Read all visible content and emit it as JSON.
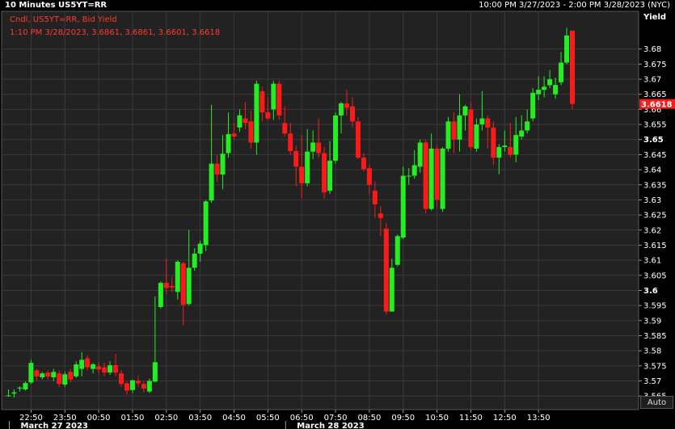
{
  "header": {
    "title": "10 Minutes US5YT=RR",
    "range": "10:00 PM 3/27/2023 - 2:00 PM 3/28/2023 (NYC)"
  },
  "legend": {
    "line1": "Cndl, US5YT=RR, Bid Yield",
    "line2": "1:10 PM 3/28/2023, 3.6861, 3.6861, 3.6601, 3.6618"
  },
  "axis": {
    "y_label": "Yield",
    "auto_label": "Auto",
    "last_price": "3.6618"
  },
  "colors": {
    "up": "#22ee22",
    "down": "#ff1a1a",
    "grid": "#3a3a3a",
    "plot_bg": "#222222",
    "price_tag": "#ff1a1a"
  },
  "chart_data": {
    "type": "candlestick",
    "ylabel": "Yield",
    "ylim": [
      3.5605,
      3.6925
    ],
    "y_ticks": [
      {
        "value": 3.68,
        "label": "3.68",
        "bold": false
      },
      {
        "value": 3.675,
        "label": "3.675",
        "bold": false
      },
      {
        "value": 3.67,
        "label": "3.67",
        "bold": false
      },
      {
        "value": 3.665,
        "label": "3.665",
        "bold": false
      },
      {
        "value": 3.66,
        "label": "3.66",
        "bold": false
      },
      {
        "value": 3.655,
        "label": "3.655",
        "bold": false
      },
      {
        "value": 3.65,
        "label": "3.65",
        "bold": true
      },
      {
        "value": 3.645,
        "label": "3.645",
        "bold": false
      },
      {
        "value": 3.64,
        "label": "3.64",
        "bold": false
      },
      {
        "value": 3.635,
        "label": "3.635",
        "bold": false
      },
      {
        "value": 3.63,
        "label": "3.63",
        "bold": false
      },
      {
        "value": 3.625,
        "label": "3.625",
        "bold": false
      },
      {
        "value": 3.62,
        "label": "3.62",
        "bold": false
      },
      {
        "value": 3.615,
        "label": "3.615",
        "bold": false
      },
      {
        "value": 3.61,
        "label": "3.61",
        "bold": false
      },
      {
        "value": 3.605,
        "label": "3.605",
        "bold": false
      },
      {
        "value": 3.6,
        "label": "3.6",
        "bold": true
      },
      {
        "value": 3.595,
        "label": "3.595",
        "bold": false
      },
      {
        "value": 3.59,
        "label": "3.59",
        "bold": false
      },
      {
        "value": 3.585,
        "label": "3.585",
        "bold": false
      },
      {
        "value": 3.58,
        "label": "3.58",
        "bold": false
      },
      {
        "value": 3.575,
        "label": "3.575",
        "bold": false
      },
      {
        "value": 3.57,
        "label": "3.57",
        "bold": false
      },
      {
        "value": 3.565,
        "label": "3.565",
        "bold": false
      }
    ],
    "x_ticks": [
      {
        "index": 4,
        "label": "22:50"
      },
      {
        "index": 10,
        "label": "23:50"
      },
      {
        "index": 16,
        "label": "00:50"
      },
      {
        "index": 22,
        "label": "01:50"
      },
      {
        "index": 28,
        "label": "02:50"
      },
      {
        "index": 34,
        "label": "03:50"
      },
      {
        "index": 40,
        "label": "04:50"
      },
      {
        "index": 46,
        "label": "05:50"
      },
      {
        "index": 52,
        "label": "06:50"
      },
      {
        "index": 58,
        "label": "07:50"
      },
      {
        "index": 64,
        "label": "08:50"
      },
      {
        "index": 70,
        "label": "09:50"
      },
      {
        "index": 76,
        "label": "10:50"
      },
      {
        "index": 82,
        "label": "11:50"
      },
      {
        "index": 88,
        "label": "12:50"
      },
      {
        "index": 94,
        "label": "13:50"
      }
    ],
    "date_labels": [
      {
        "index": 0,
        "label": "March 27 2023"
      },
      {
        "index": 49,
        "label": "March 28 2023"
      }
    ],
    "candles": [
      [
        3.5652,
        3.5652,
        3.5648,
        3.5672
      ],
      [
        3.5658,
        3.5662,
        3.5645,
        3.5672
      ],
      [
        3.5675,
        3.5678,
        3.5665,
        3.5682
      ],
      [
        3.5672,
        3.5693,
        3.5668,
        3.5698
      ],
      [
        3.5695,
        3.576,
        3.569,
        3.577
      ],
      [
        3.5735,
        3.5715,
        3.57,
        3.574
      ],
      [
        3.5712,
        3.5725,
        3.5705,
        3.573
      ],
      [
        3.5728,
        3.5715,
        3.5705,
        3.5735
      ],
      [
        3.5712,
        3.573,
        3.57,
        3.574
      ],
      [
        3.5725,
        3.569,
        3.568,
        3.5735
      ],
      [
        3.5688,
        3.5722,
        3.568,
        3.573
      ],
      [
        3.573,
        3.5705,
        3.5695,
        3.574
      ],
      [
        3.5715,
        3.5755,
        3.571,
        3.5765
      ],
      [
        3.574,
        3.577,
        3.5715,
        3.5795
      ],
      [
        3.5775,
        3.5745,
        3.5735,
        3.5785
      ],
      [
        3.574,
        3.5755,
        3.5725,
        3.576
      ],
      [
        3.5748,
        3.5738,
        3.5725,
        3.5765
      ],
      [
        3.5745,
        3.5728,
        3.5715,
        3.576
      ],
      [
        3.5728,
        3.5752,
        3.572,
        3.5765
      ],
      [
        3.5752,
        3.5728,
        3.5715,
        3.579
      ],
      [
        3.5725,
        3.569,
        3.568,
        3.5735
      ],
      [
        3.5692,
        3.5668,
        3.5655,
        3.5698
      ],
      [
        3.567,
        3.5702,
        3.566,
        3.5705
      ],
      [
        3.57,
        3.5692,
        3.568,
        3.5718
      ],
      [
        3.569,
        3.5675,
        3.5662,
        3.57
      ],
      [
        3.5665,
        3.57,
        3.566,
        3.5708
      ],
      [
        3.5698,
        3.5762,
        3.5695,
        3.598
      ],
      [
        3.5945,
        3.6025,
        3.594,
        3.603
      ],
      [
        3.6025,
        3.6008,
        3.599,
        3.6105
      ],
      [
        3.6015,
        3.601,
        3.5995,
        3.6045
      ],
      [
        3.5995,
        3.6095,
        3.597,
        3.61
      ],
      [
        3.609,
        3.5952,
        3.5885,
        3.6095
      ],
      [
        3.5955,
        3.6075,
        3.595,
        3.62
      ],
      [
        3.6075,
        3.6122,
        3.6065,
        3.614
      ],
      [
        3.6122,
        3.6155,
        3.6095,
        3.6165
      ],
      [
        3.615,
        3.6295,
        3.613,
        3.63
      ],
      [
        3.6298,
        3.642,
        3.629,
        3.6615
      ],
      [
        3.642,
        3.6384,
        3.636,
        3.645
      ],
      [
        3.6384,
        3.6453,
        3.6335,
        3.6515
      ],
      [
        3.6455,
        3.6518,
        3.644,
        3.659
      ],
      [
        3.652,
        3.651,
        3.65,
        3.6555
      ],
      [
        3.654,
        3.658,
        3.6525,
        3.66
      ],
      [
        3.657,
        3.6555,
        3.6535,
        3.6625
      ],
      [
        3.656,
        3.649,
        3.647,
        3.6595
      ],
      [
        3.649,
        3.6685,
        3.645,
        3.6695
      ],
      [
        3.666,
        3.659,
        3.656,
        3.6675
      ],
      [
        3.659,
        3.657,
        3.6565,
        3.664
      ],
      [
        3.66,
        3.6685,
        3.6565,
        3.6695
      ],
      [
        3.6685,
        3.658,
        3.6565,
        3.6695
      ],
      [
        3.6555,
        3.652,
        3.651,
        3.661
      ],
      [
        3.652,
        3.6462,
        3.645,
        3.6555
      ],
      [
        3.6462,
        3.641,
        3.6345,
        3.648
      ],
      [
        3.641,
        3.6355,
        3.6305,
        3.6515
      ],
      [
        3.6355,
        3.646,
        3.6345,
        3.6535
      ],
      [
        3.646,
        3.649,
        3.6435,
        3.653
      ],
      [
        3.649,
        3.6455,
        3.644,
        3.657
      ],
      [
        3.6455,
        3.6325,
        3.6305,
        3.6475
      ],
      [
        3.633,
        3.643,
        3.632,
        3.6495
      ],
      [
        3.643,
        3.658,
        3.642,
        3.659
      ],
      [
        3.658,
        3.662,
        3.652,
        3.6625
      ],
      [
        3.662,
        3.6605,
        3.658,
        3.6665
      ],
      [
        3.661,
        3.656,
        3.654,
        3.664
      ],
      [
        3.656,
        3.644,
        3.6435,
        3.6575
      ],
      [
        3.644,
        3.6402,
        3.6395,
        3.6455
      ],
      [
        3.6405,
        3.635,
        3.632,
        3.6415
      ],
      [
        3.633,
        3.6285,
        3.624,
        3.636
      ],
      [
        3.6255,
        3.624,
        3.618,
        3.628
      ],
      [
        3.6205,
        3.593,
        3.592,
        3.6225
      ],
      [
        3.593,
        3.6075,
        3.593,
        3.6105
      ],
      [
        3.6085,
        3.618,
        3.608,
        3.6185
      ],
      [
        3.6175,
        3.638,
        3.617,
        3.641
      ],
      [
        3.638,
        3.638,
        3.635,
        3.6405
      ],
      [
        3.638,
        3.6415,
        3.637,
        3.6465
      ],
      [
        3.641,
        3.649,
        3.639,
        3.65
      ],
      [
        3.649,
        3.627,
        3.6255,
        3.65
      ],
      [
        3.627,
        3.647,
        3.6265,
        3.652
      ],
      [
        3.647,
        3.63,
        3.6275,
        3.648
      ],
      [
        3.627,
        3.647,
        3.626,
        3.6475
      ],
      [
        3.647,
        3.656,
        3.646,
        3.6575
      ],
      [
        3.656,
        3.65,
        3.6455,
        3.659
      ],
      [
        3.65,
        3.658,
        3.646,
        3.665
      ],
      [
        3.658,
        3.661,
        3.653,
        3.6615
      ],
      [
        3.66,
        3.6475,
        3.6465,
        3.6625
      ],
      [
        3.647,
        3.655,
        3.646,
        3.657
      ],
      [
        3.655,
        3.657,
        3.653,
        3.666
      ],
      [
        3.657,
        3.654,
        3.647,
        3.658
      ],
      [
        3.654,
        3.644,
        3.6415,
        3.656
      ],
      [
        3.644,
        3.6475,
        3.6385,
        3.6485
      ],
      [
        3.6475,
        3.648,
        3.646,
        3.653
      ],
      [
        3.6475,
        3.645,
        3.644,
        3.6555
      ],
      [
        3.645,
        3.6515,
        3.6425,
        3.6575
      ],
      [
        3.651,
        3.653,
        3.65,
        3.658
      ],
      [
        3.653,
        3.656,
        3.652,
        3.66
      ],
      [
        3.657,
        3.6655,
        3.656,
        3.667
      ],
      [
        3.665,
        3.6665,
        3.663,
        3.671
      ],
      [
        3.6665,
        3.6675,
        3.664,
        3.671
      ],
      [
        3.668,
        3.67,
        3.667,
        3.673
      ],
      [
        3.665,
        3.6681,
        3.6635,
        3.6705
      ],
      [
        3.669,
        3.6755,
        3.668,
        3.679
      ],
      [
        3.6755,
        3.6845,
        3.675,
        3.687
      ],
      [
        3.6861,
        3.6618,
        3.6601,
        3.6861
      ]
    ]
  }
}
